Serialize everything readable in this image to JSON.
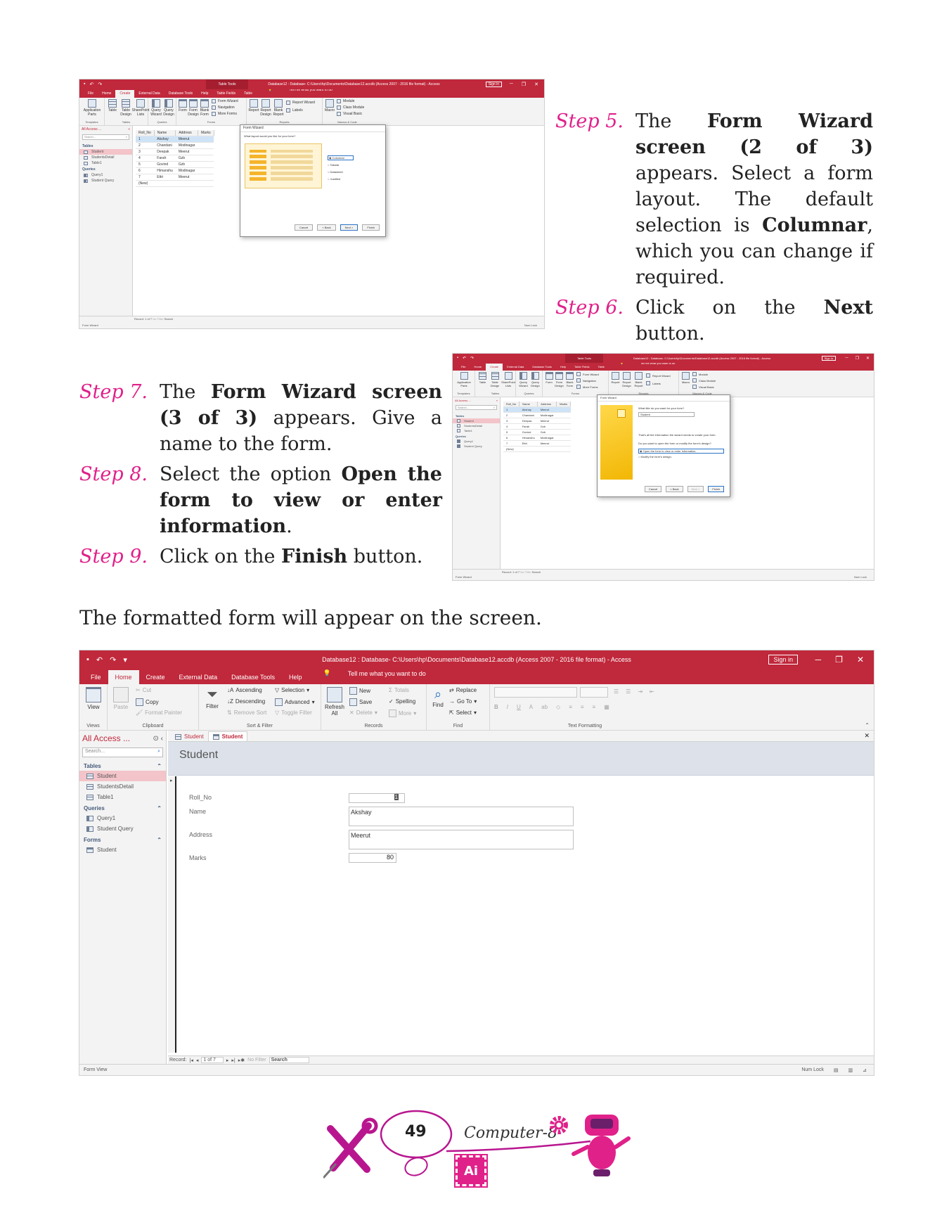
{
  "steps": {
    "s5": {
      "label": "Step 5.",
      "parts": [
        "The ",
        "Form Wizard screen (2 of 3)",
        " appears. Select a form layout. The default selection is ",
        "Columnar",
        ", which you can change if required."
      ]
    },
    "s6": {
      "label": "Step 6.",
      "parts": [
        "Click on the ",
        "Next",
        " button."
      ]
    },
    "s7": {
      "label": "Step 7.",
      "parts": [
        "The ",
        "Form Wizard screen (3 of 3)",
        " appears. Give a name to the form."
      ]
    },
    "s8": {
      "label": "Step 8.",
      "parts": [
        "Select the option ",
        "Open the form to view or enter information",
        "."
      ]
    },
    "s9": {
      "label": "Step 9.",
      "parts": [
        "Click on the ",
        "Finish",
        " button."
      ]
    }
  },
  "note": "The formatted form will appear on the screen.",
  "window": {
    "title": "Database12 : Database- C:\\Users\\hp\\Documents\\Database12.accdb (Access 2007 - 2016 file format) - Access",
    "signin": "Sign in",
    "minimize": "─",
    "restore": "❐",
    "close": "✕",
    "tabs": [
      "File",
      "Home",
      "Create",
      "External Data",
      "Database Tools",
      "Help"
    ],
    "tell_me": "Tell me what you want to do",
    "small_tabs": [
      "File",
      "Home",
      "Create",
      "External Data",
      "Database Tools",
      "Help",
      "Table Fields",
      "Table"
    ],
    "table_tools": "Table Tools"
  },
  "ribbon": {
    "views": {
      "view": "View",
      "label": "Views"
    },
    "clipboard": {
      "paste": "Paste",
      "cut": "Cut",
      "copy": "Copy",
      "format_painter": "Format Painter",
      "label": "Clipboard"
    },
    "sort_filter": {
      "filter": "Filter",
      "ascending": "Ascending",
      "descending": "Descending",
      "remove_sort": "Remove Sort",
      "selection": "Selection",
      "advanced": "Advanced",
      "toggle_filter": "Toggle Filter",
      "label": "Sort & Filter"
    },
    "records": {
      "refresh": "Refresh All",
      "new": "New",
      "save": "Save",
      "delete": "Delete",
      "totals": "Totals",
      "spelling": "Spelling",
      "more": "More",
      "label": "Records"
    },
    "find": {
      "find": "Find",
      "replace": "Replace",
      "goto": "Go To",
      "select": "Select",
      "label": "Find"
    },
    "text_formatting": {
      "label": "Text Formatting",
      "bold": "B",
      "italic": "I",
      "underline": "U",
      "font_color": "A"
    },
    "create": {
      "application_parts": "Application Parts",
      "table": "Table",
      "table_design": "Table Design",
      "sharepoint_lists": "SharePoint Lists",
      "query_wizard": "Query Wizard",
      "query_design": "Query Design",
      "form": "Form",
      "form_design": "Form Design",
      "blank_form": "Blank Form",
      "form_wizard": "Form Wizard",
      "navigation": "Navigation",
      "more_forms": "More Forms",
      "report": "Report",
      "report_design": "Report Design",
      "blank_report": "Blank Report",
      "report_wizard": "Report Wizard",
      "labels": "Labels",
      "macro": "Macro",
      "module": "Module",
      "class_module": "Class Module",
      "visual_basic": "Visual Basic",
      "groups": [
        "Templates",
        "Tables",
        "Queries",
        "Forms",
        "Reports",
        "Macros & Code"
      ]
    }
  },
  "nav": {
    "header": "All Access ...",
    "search": "Search...",
    "tables_label": "Tables",
    "tables": [
      "Student",
      "StudentsDetail",
      "Table1"
    ],
    "queries_label": "Queries",
    "queries": [
      "Query1",
      "Student Query"
    ],
    "forms_label": "Forms",
    "forms": [
      "Student"
    ]
  },
  "grid": {
    "headers": [
      "Roll_No",
      "Name",
      "Address",
      "Marks"
    ],
    "rows": [
      [
        "1",
        "Akshay",
        "Meerut"
      ],
      [
        "2",
        "Chandani",
        "Modinagar"
      ],
      [
        "3",
        "Deepak",
        "Meerut"
      ],
      [
        "4",
        "Farah",
        "Gzb"
      ],
      [
        "5",
        "Govind",
        "Gzb"
      ],
      [
        "6",
        "Himanshu",
        "Modinagar"
      ],
      [
        "7",
        "Ettri",
        "Meerut"
      ]
    ],
    "new_row": "(New)"
  },
  "wizard2": {
    "title": "Form Wizard",
    "question": "What layout would you like for your form?",
    "options": [
      "Columnar",
      "Tabular",
      "Datasheet",
      "Justified"
    ],
    "buttons": [
      "Cancel",
      "< Back",
      "Next >",
      "Finish"
    ]
  },
  "wizard3": {
    "title": "Form Wizard",
    "question": "What title do you want for your form?",
    "form_name": "Student",
    "info": "That's all the information the wizard needs to create your form.",
    "question2": "Do you want to open the form or modify the form's design?",
    "options": [
      "Open the form to view or enter information.",
      "Modify the form's design."
    ],
    "buttons": [
      "Cancel",
      "< Back",
      "Next >",
      "Finish"
    ]
  },
  "form": {
    "doc_tabs": [
      "Student",
      "Student"
    ],
    "header": "Student",
    "fields": [
      {
        "label": "Roll_No",
        "value": "1"
      },
      {
        "label": "Name",
        "value": "Akshay"
      },
      {
        "label": "Address",
        "value": "Meerut"
      },
      {
        "label": "Marks",
        "value": "80"
      }
    ]
  },
  "status": {
    "record_label": "Record:",
    "record_pos": "1 of 7",
    "no_filter": "No Filter",
    "search": "Search",
    "view_big": "Form View",
    "view_small": "Form Wizard",
    "num_lock": "Num Lock"
  },
  "footer": {
    "page": "49",
    "book": "Computer-8",
    "badge": "Ai"
  },
  "colors": {
    "access_red": "#c0283b",
    "step_pink": "#e0218a",
    "footer_magenta": "#e0218a"
  }
}
